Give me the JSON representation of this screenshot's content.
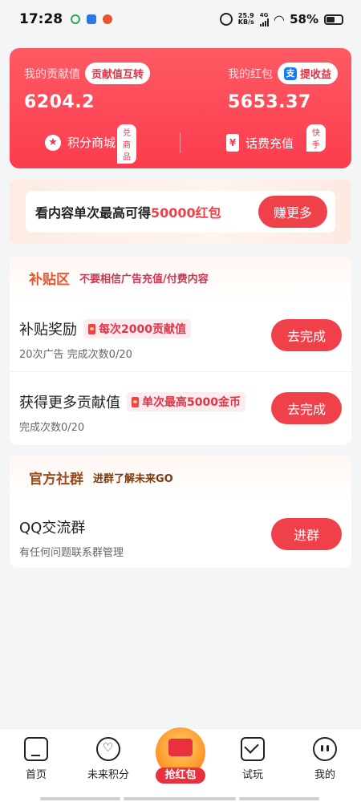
{
  "status_bar": {
    "time": "17:28",
    "net_speed_value": "25.9",
    "net_speed_unit": "KB/s",
    "network": "4G",
    "battery": "58%"
  },
  "top_card": {
    "contribution": {
      "label": "我的贡献值",
      "pill": "贡献值互转",
      "value": "6204.2"
    },
    "redpacket": {
      "label": "我的红包",
      "pill": "提收益",
      "value": "5653.37"
    },
    "points_mall": {
      "label": "积分商城",
      "tag": "兑商品"
    },
    "phone_recharge": {
      "label": "话费充值",
      "tag": "快手"
    }
  },
  "banner": {
    "text_prefix": "看内容单次最高可得",
    "text_highlight": "50000红包",
    "button": "赚更多"
  },
  "subsidy_section": {
    "title": "补贴区",
    "subtitle": "不要相信广告充值/付费内容",
    "tasks": [
      {
        "title": "补贴奖励",
        "badge": "每次2000贡献值",
        "desc": "20次广告  完成次数0/20",
        "button": "去完成"
      },
      {
        "title": "获得更多贡献值",
        "badge": "单次最高5000金币",
        "desc": "完成次数0/20",
        "button": "去完成"
      }
    ]
  },
  "community_section": {
    "title": "官方社群",
    "subtitle": "进群了解未来GO",
    "item": {
      "title": "QQ交流群",
      "desc": "有任何问题联系群管理",
      "button": "进群"
    }
  },
  "bottom_nav": {
    "home": "首页",
    "points": "未来积分",
    "redpacket": "抢红包",
    "trial": "试玩",
    "mine": "我的"
  }
}
